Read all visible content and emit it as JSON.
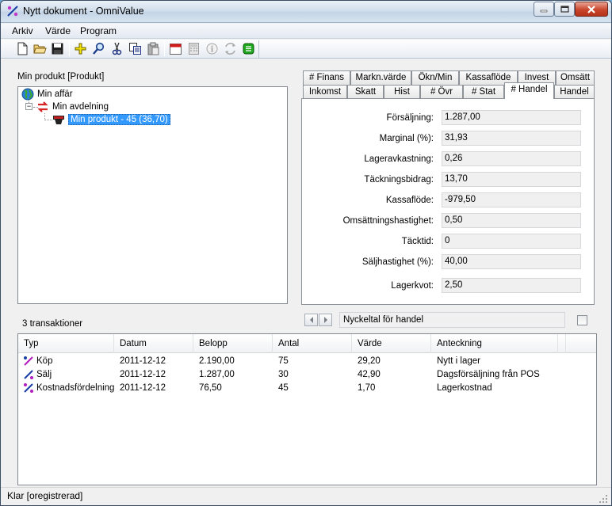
{
  "window": {
    "title": "Nytt dokument - OmniValue",
    "controls": {
      "minimize": "minimize-icon",
      "maximize": "maximize-icon",
      "close": "close-icon"
    }
  },
  "menu": {
    "items": [
      "Arkiv",
      "Värde",
      "Program"
    ]
  },
  "toolbar": {
    "icons": [
      "new-document-icon",
      "open-folder-icon",
      "save-icon",
      "add-icon",
      "find-icon",
      "cut-icon",
      "copy-icon",
      "paste-icon",
      "calendar-icon",
      "calculator-icon",
      "info-icon",
      "refresh-icon",
      "list-icon"
    ]
  },
  "tree": {
    "caption": "Min produkt  [Produkt]",
    "nodes": [
      {
        "label": "Min affär",
        "icon": "globe-icon"
      },
      {
        "label": "Min avdelning",
        "icon": "transfer-arrows-icon"
      },
      {
        "label": "Min produkt - 45 (36,70)",
        "icon": "product-box-icon",
        "selected": true
      }
    ]
  },
  "tabs": {
    "row_top": [
      "# Finans",
      "Markn.värde",
      "Ökn/Min",
      "Kassaflöde",
      "Invest",
      "Omsätt"
    ],
    "row_bottom": [
      "Inkomst",
      "Skatt",
      "Hist",
      "# Övr",
      "# Stat",
      "# Handel",
      "Handel"
    ],
    "active": "# Handel"
  },
  "fields": [
    {
      "label": "Försäljning:",
      "value": "1.287,00"
    },
    {
      "label": "Marginal (%):",
      "value": "31,93"
    },
    {
      "label": "Lageravkastning:",
      "value": "0,26"
    },
    {
      "label": "Täckningsbidrag:",
      "value": "13,70"
    },
    {
      "label": "Kassaflöde:",
      "value": "-979,50"
    },
    {
      "label": "Omsättningshastighet:",
      "value": "0,50"
    },
    {
      "label": "Täcktid:",
      "value": "0"
    },
    {
      "label": "Säljhastighet (%):",
      "value": "40,00"
    },
    {
      "label": "Lagerkvot:",
      "value": "2,50"
    }
  ],
  "nav": {
    "description": "Nyckeltal för handel"
  },
  "transactions": {
    "caption": "3 transaktioner",
    "columns": [
      "Typ",
      "Datum",
      "Belopp",
      "Antal",
      "Värde",
      "Anteckning"
    ],
    "rows": [
      {
        "typ": "Köp",
        "datum": "2011-12-12",
        "belopp": "2.190,00",
        "antal": "75",
        "varde": "29,20",
        "anteckning": "Nytt i lager",
        "icon": "buy-icon"
      },
      {
        "typ": "Sälj",
        "datum": "2011-12-12",
        "belopp": "1.287,00",
        "antal": "30",
        "varde": "42,90",
        "anteckning": "Dagsförsäljning från POS",
        "icon": "sell-icon"
      },
      {
        "typ": "Kostnadsfördelning",
        "datum": "2011-12-12",
        "belopp": "76,50",
        "antal": "45",
        "varde": "1,70",
        "anteckning": "Lagerkostnad",
        "icon": "cost-icon"
      }
    ]
  },
  "status": {
    "text": "Klar [oregistrerad]"
  }
}
